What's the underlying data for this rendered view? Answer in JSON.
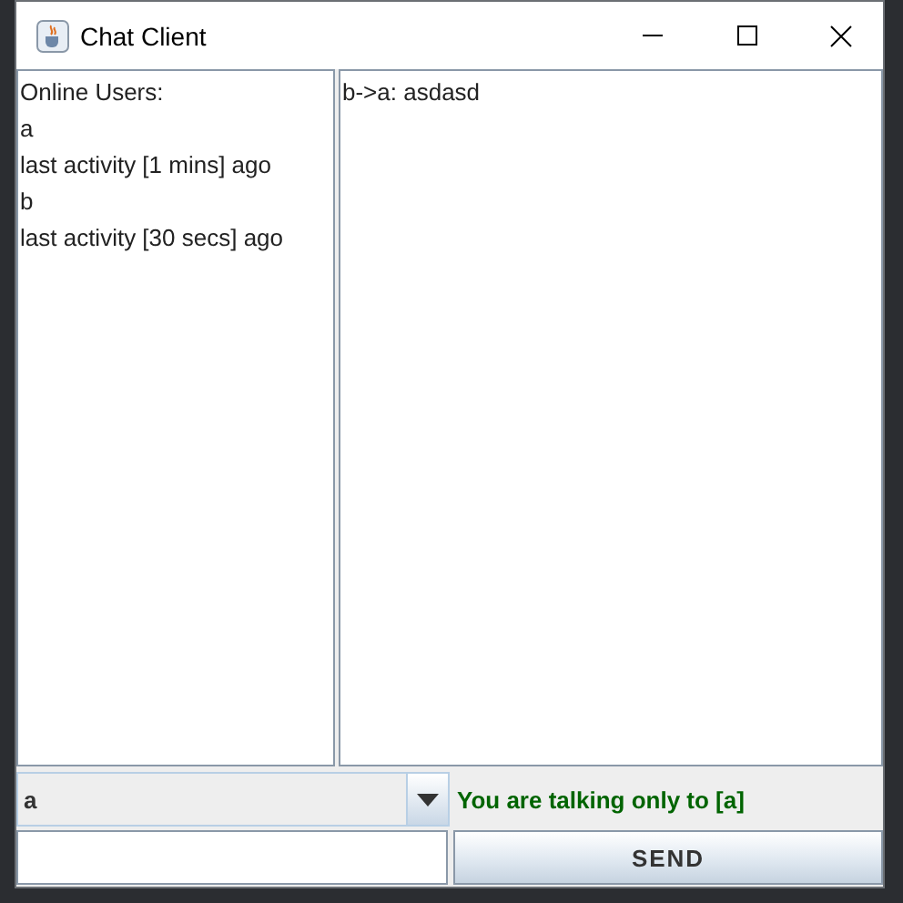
{
  "window": {
    "title": "Chat Client"
  },
  "users_panel": {
    "lines": [
      "Online Users:",
      "a",
      "last activity [1 mins] ago",
      "b",
      "last activity [30 secs] ago"
    ]
  },
  "messages": [
    "b->a: asdasd"
  ],
  "recipient_combo": {
    "value": "a"
  },
  "status": "You are talking only to [a]",
  "send_button": "SEND"
}
